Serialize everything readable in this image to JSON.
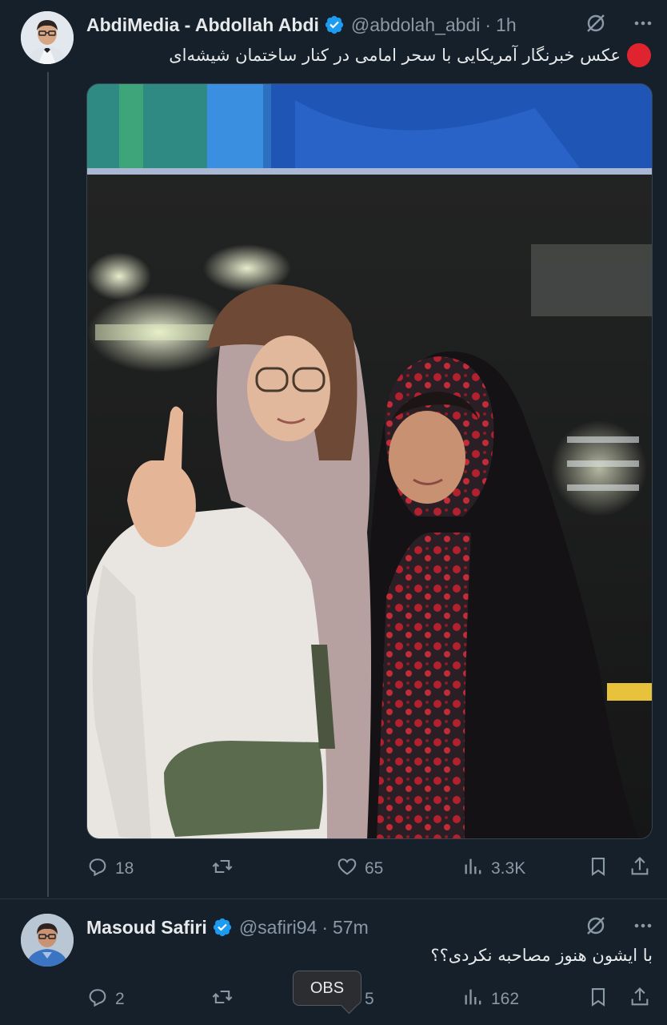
{
  "tweets": [
    {
      "name": "AbdiMedia - Abdollah Abdi",
      "handle": "@abdolah_abdi",
      "time": "1h",
      "text": "عکس خبرنگار آمریکایی با سحر امامی در کنار ساختمان شیشه‌ای",
      "stats": {
        "replies": "18",
        "reposts": "",
        "likes": "65",
        "views": "3.3K"
      }
    },
    {
      "name": "Masoud Safiri",
      "handle": "@safiri94",
      "time": "57m",
      "text": "با ایشون هنوز مصاحبه نکردی؟؟",
      "stats": {
        "replies": "2",
        "reposts": "",
        "likes": "5",
        "views": "162"
      }
    }
  ],
  "separator": "·",
  "tooltip": "OBS",
  "icons": {
    "verified": "verified-badge-icon",
    "grok": "grok-icon",
    "more": "more-icon",
    "reply": "reply-icon",
    "repost": "repost-icon",
    "like": "like-icon",
    "views": "views-icon",
    "bookmark": "bookmark-icon",
    "share": "share-icon"
  },
  "colors": {
    "background": "#15202b",
    "muted": "#8b98a5",
    "verified": "#1d9bf0",
    "red_dot": "#e0242f"
  }
}
